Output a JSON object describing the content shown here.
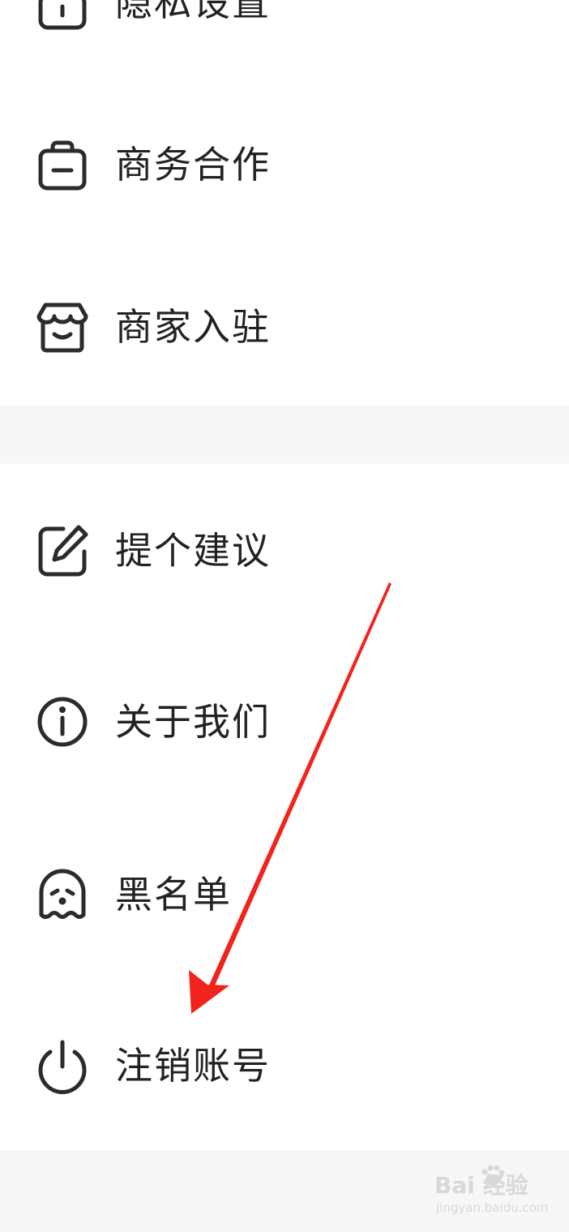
{
  "menu_top": {
    "items": [
      {
        "label": "隐私设置",
        "icon": "lock-icon"
      },
      {
        "label": "商务合作",
        "icon": "briefcase-icon"
      },
      {
        "label": "商家入驻",
        "icon": "store-icon"
      }
    ]
  },
  "menu_bottom": {
    "items": [
      {
        "label": "提个建议",
        "icon": "edit-icon"
      },
      {
        "label": "关于我们",
        "icon": "info-icon"
      },
      {
        "label": "黑名单",
        "icon": "ghost-icon"
      },
      {
        "label": "注销账号",
        "icon": "power-icon"
      }
    ]
  },
  "annotation": {
    "color": "#f0241c",
    "points_to": "注销账号"
  },
  "watermark": {
    "main": "Bai 经验",
    "sub": "jingyan.baidu.com"
  }
}
